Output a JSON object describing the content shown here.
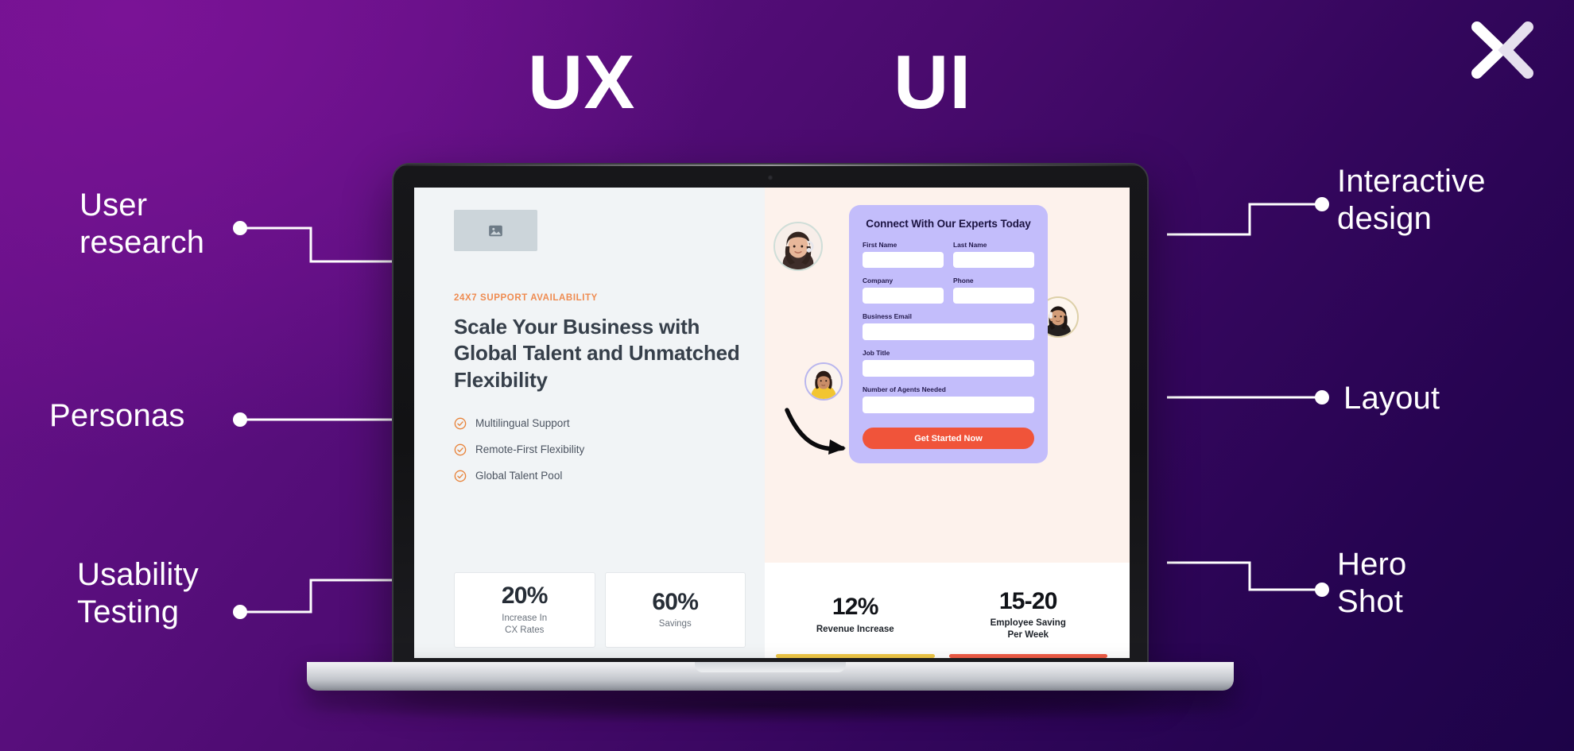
{
  "wordmarks": {
    "ux": "UX",
    "ui": "UI"
  },
  "logo": {
    "name": "x-logo"
  },
  "annotations": {
    "left": [
      {
        "label": "User\nresearch",
        "name": "annotation-user-research"
      },
      {
        "label": "Personas",
        "name": "annotation-personas"
      },
      {
        "label": "Usability\nTesting",
        "name": "annotation-usability-testing"
      }
    ],
    "right": [
      {
        "label": "Interactive\ndesign",
        "name": "annotation-interactive-design"
      },
      {
        "label": "Layout",
        "name": "annotation-layout"
      },
      {
        "label": "Hero\nShot",
        "name": "annotation-hero-shot"
      }
    ]
  },
  "screen": {
    "hero": {
      "eyebrow": "24X7 SUPPORT AVAILABILITY",
      "heading": "Scale Your Business with Global Talent and Unmatched Flexibility",
      "features": [
        "Multilingual Support",
        "Remote-First Flexibility",
        "Global Talent Pool"
      ]
    },
    "form": {
      "title": "Connect With Our Experts Today",
      "fields": [
        {
          "label": "First Name",
          "value": ""
        },
        {
          "label": "Last Name",
          "value": ""
        },
        {
          "label": "Company",
          "value": ""
        },
        {
          "label": "Phone",
          "value": ""
        },
        {
          "label": "Business Email",
          "value": ""
        },
        {
          "label": "Job Title",
          "value": ""
        },
        {
          "label": "Number of Agents Needed",
          "value": ""
        }
      ],
      "cta": "Get Started Now"
    },
    "stats": [
      {
        "value": "20%",
        "label": "Increase In\nCX Rates",
        "accent": ""
      },
      {
        "value": "60%",
        "label": "Savings",
        "accent": ""
      },
      {
        "value": "12%",
        "label": "Revenue Increase",
        "accent": "#efc746"
      },
      {
        "value": "15-20",
        "label": "Employee Saving\nPer Week",
        "accent": "#ef5c46"
      }
    ]
  },
  "colors": {
    "bg_top_left": "#6d118b",
    "bg_bottom_right": "#1d0348",
    "accent_orange": "#ef8b50",
    "cta_orange": "#f0543a",
    "form_lavender": "#c3bdfb",
    "panel_cool": "#f1f4f6",
    "panel_warm": "#fdf2ec"
  }
}
